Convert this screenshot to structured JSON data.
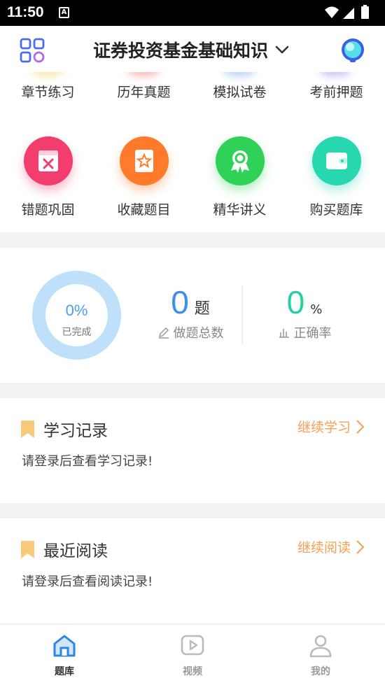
{
  "status_bar": {
    "time": "11:50",
    "badge": "A"
  },
  "header": {
    "title": "证券投资基金基础知识"
  },
  "features_row1": [
    {
      "label": "章节练习"
    },
    {
      "label": "历年真题"
    },
    {
      "label": "模拟试卷"
    },
    {
      "label": "考前押题"
    }
  ],
  "features_row2": [
    {
      "label": "错题巩固",
      "icon": "wrong-questions-icon",
      "color": "#f23d6e"
    },
    {
      "label": "收藏题目",
      "icon": "favorites-icon",
      "color": "#ff7a2a"
    },
    {
      "label": "精华讲义",
      "icon": "award-icon",
      "color": "#2fd157"
    },
    {
      "label": "购买题库",
      "icon": "wallet-icon",
      "color": "#27d7b0"
    }
  ],
  "stats": {
    "progress_value": "0%",
    "progress_fraction": 0,
    "progress_label": "已完成",
    "total_value": "0",
    "total_unit": "题",
    "total_label": "做题总数",
    "accuracy_value": "0",
    "accuracy_unit": "%",
    "accuracy_label": "正确率"
  },
  "study_record": {
    "title": "学习记录",
    "action": "继续学习",
    "message": "请登录后查看学习记录!"
  },
  "recent_reading": {
    "title": "最近阅读",
    "action": "继续阅读",
    "message": "请登录后查看阅读记录!"
  },
  "tabs": [
    {
      "label": "题库",
      "active": true
    },
    {
      "label": "视频",
      "active": false
    },
    {
      "label": "我的",
      "active": false
    }
  ],
  "colors": {
    "accent_blue": "#3d8fe8",
    "accent_teal": "#27cfa8",
    "accent_orange": "#f5a054",
    "ring": "#bfe0fb"
  }
}
